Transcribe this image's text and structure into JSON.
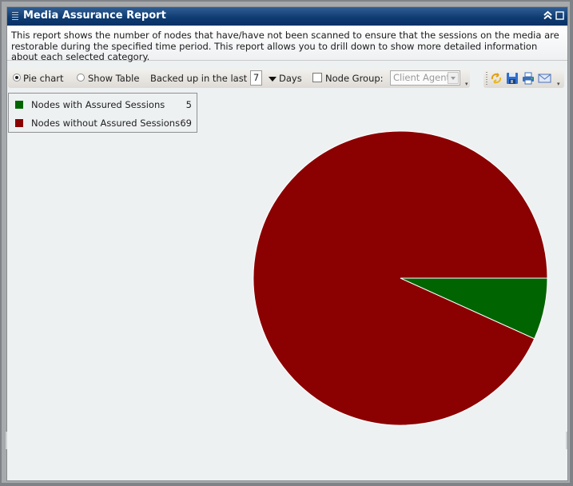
{
  "window": {
    "title": "Media Assurance Report",
    "collapse_icon": "double-chevron-up-icon",
    "maximize_icon": "square-icon"
  },
  "description": "This report shows the number of nodes that have/have not been scanned to ensure that the sessions on the media are restorable during the specified time period. This report allows you to drill down to show more detailed information about each selected category.",
  "toolbar": {
    "view_options": [
      {
        "label": "Pie chart",
        "selected": true
      },
      {
        "label": "Show Table",
        "selected": false
      }
    ],
    "backed_up_label": "Backed up in the last",
    "days_value": "7",
    "days_label": "Days",
    "node_group_checked": false,
    "node_group_label": "Node Group:",
    "node_group_value": "Client Agent",
    "actions": [
      {
        "name": "refresh-icon",
        "label": "Refresh"
      },
      {
        "name": "save-icon",
        "label": "Save"
      },
      {
        "name": "print-icon",
        "label": "Print"
      },
      {
        "name": "email-icon",
        "label": "Email"
      }
    ]
  },
  "colors": {
    "assured": "#006400",
    "not_assured": "#8b0000",
    "title_bar": "#0d3a70"
  },
  "chart_data": {
    "type": "pie",
    "title": "",
    "legend_position": "top-left",
    "slices": [
      {
        "label": "Nodes with Assured Sessions",
        "value": 5,
        "color": "#006400"
      },
      {
        "label": "Nodes without Assured Sessions",
        "value": 69,
        "color": "#8b0000"
      }
    ],
    "start_angle": "3 o'clock",
    "direction": "clockwise"
  }
}
